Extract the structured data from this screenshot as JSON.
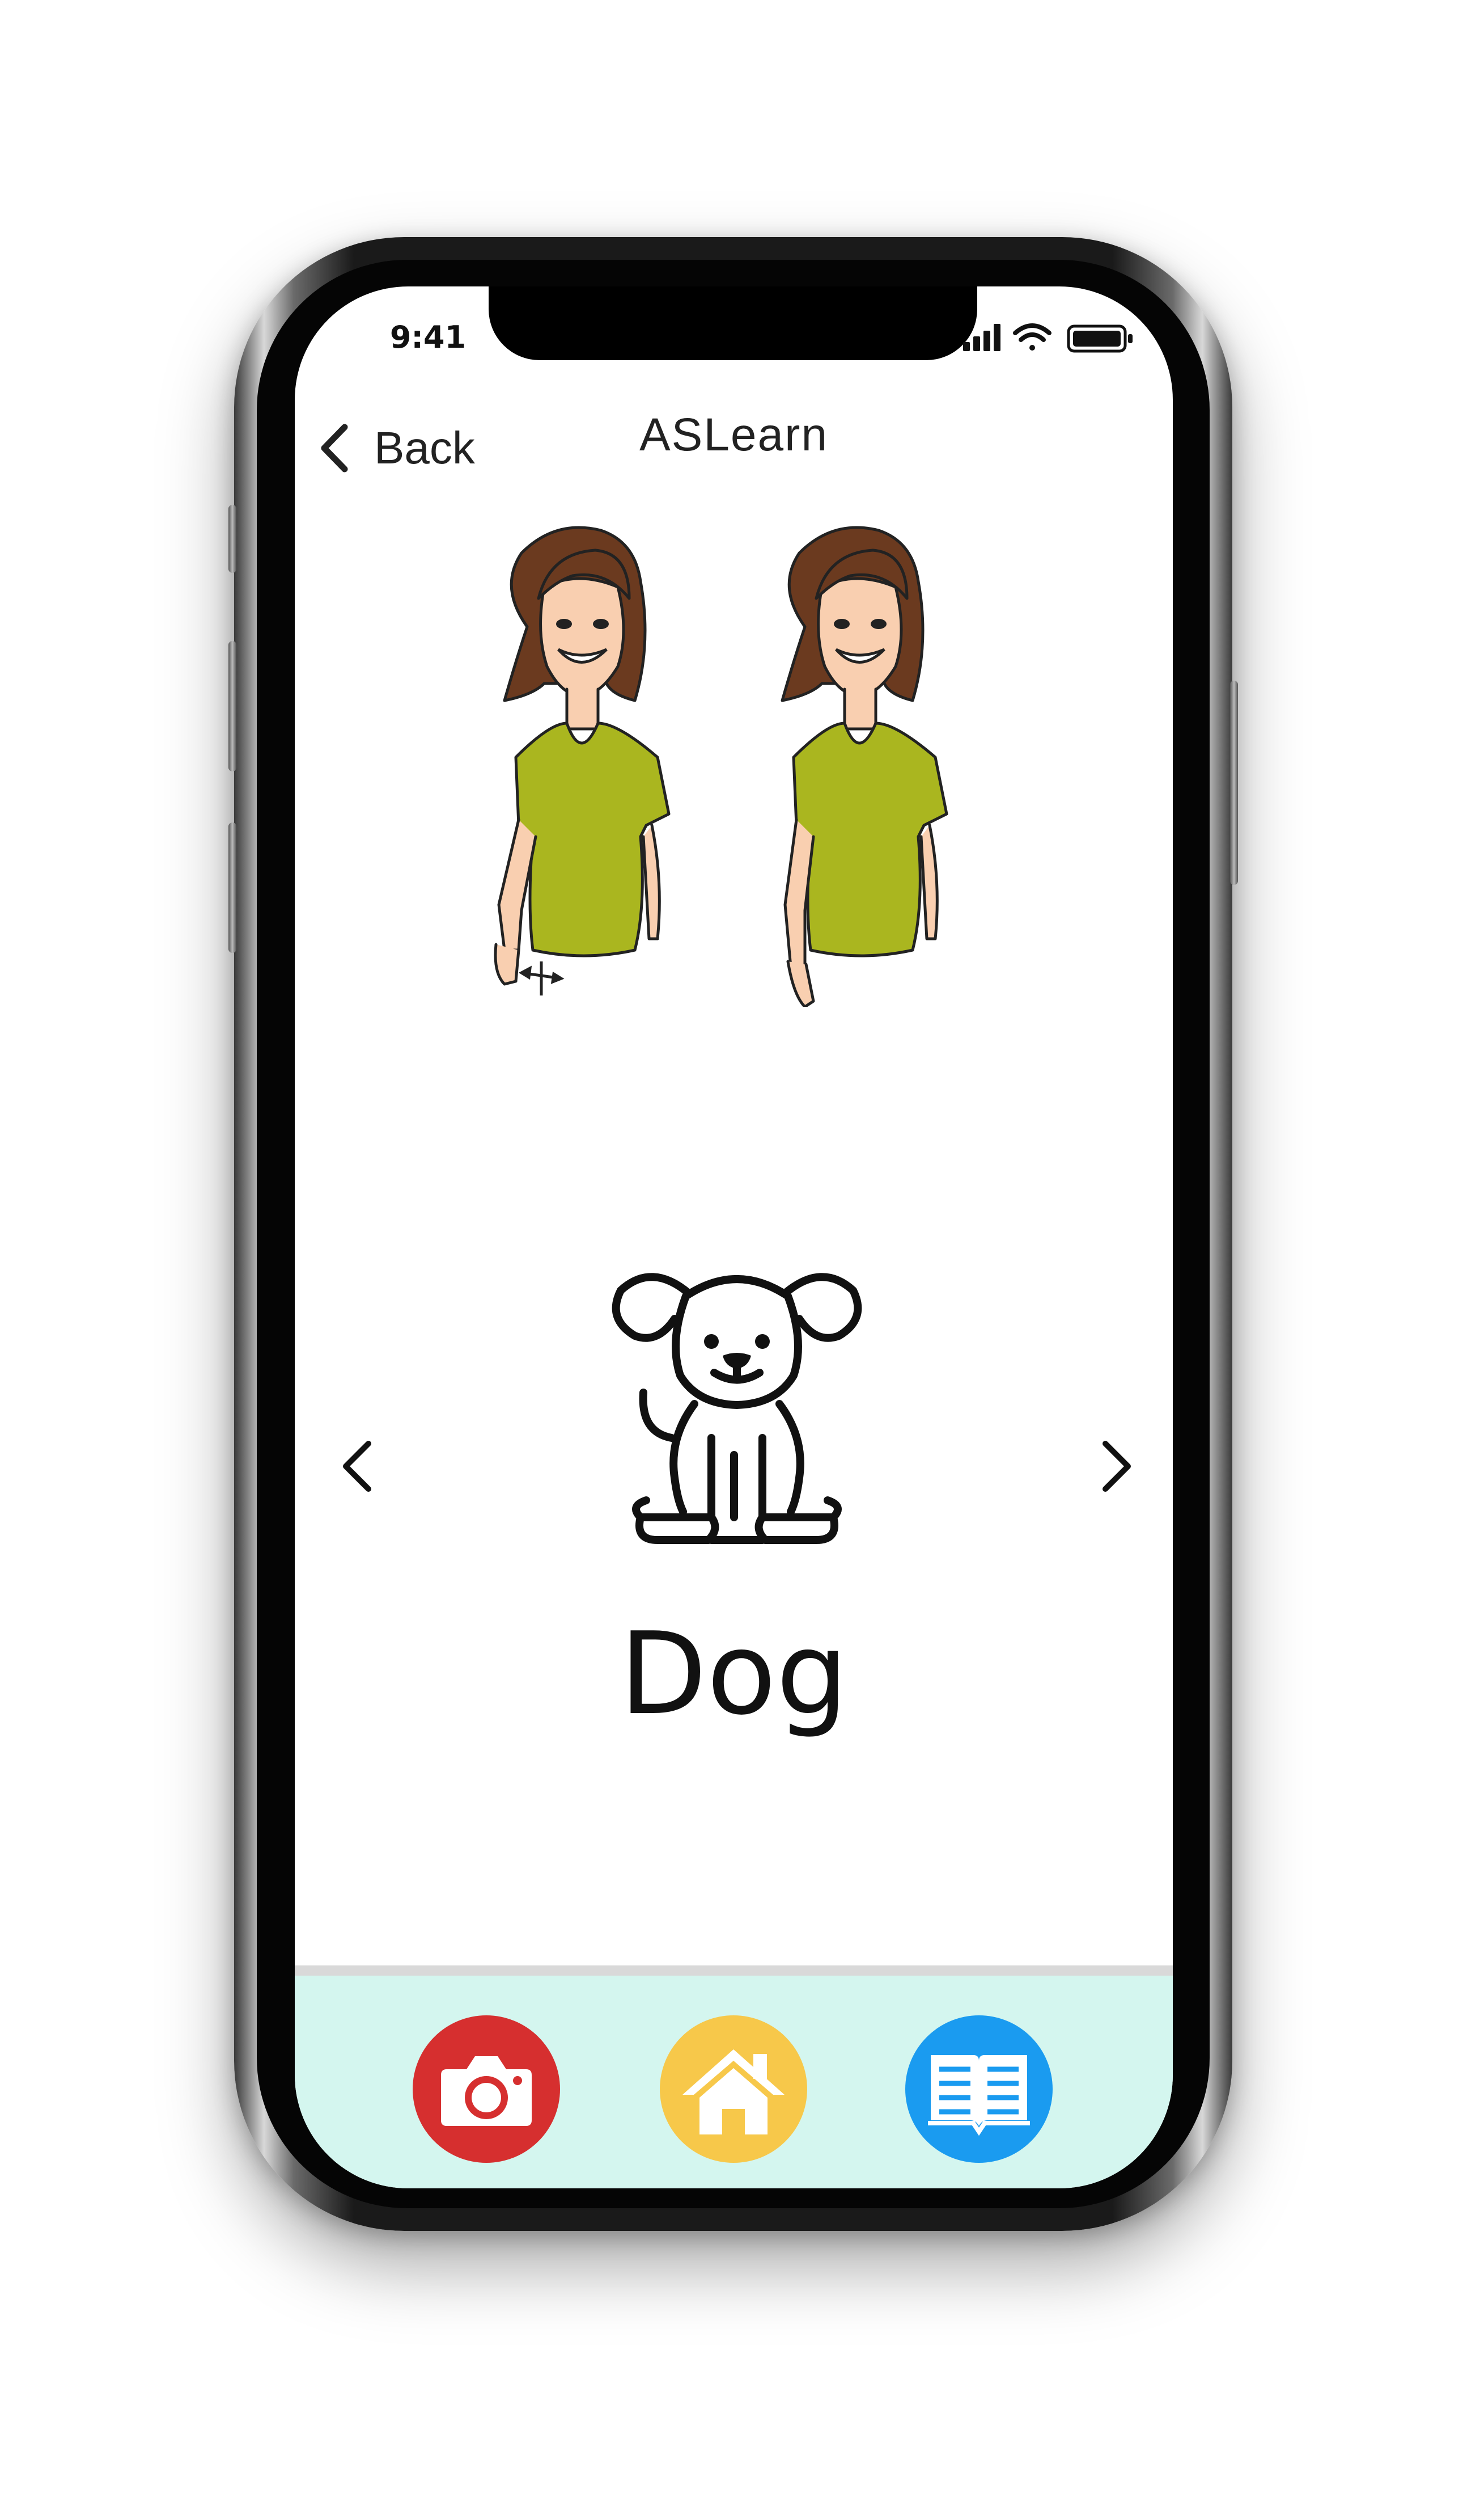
{
  "status_bar": {
    "time": "9:41"
  },
  "header": {
    "back_label": "Back",
    "title": "ASLearn"
  },
  "flashcard": {
    "word": "Dog"
  },
  "colors": {
    "camera": "#d62f2f",
    "home": "#f7c84a",
    "library": "#1a9bf0",
    "tabbar_bg": "#d4f6ef",
    "shirt": "#aab61f",
    "hair": "#6b3a1f"
  },
  "icons": {
    "back": "chevron-left-icon",
    "prev": "chevron-left-icon",
    "next": "chevron-right-icon",
    "card": "dog-icon",
    "camera": "camera-icon",
    "home": "home-icon",
    "library": "open-book-icon"
  }
}
